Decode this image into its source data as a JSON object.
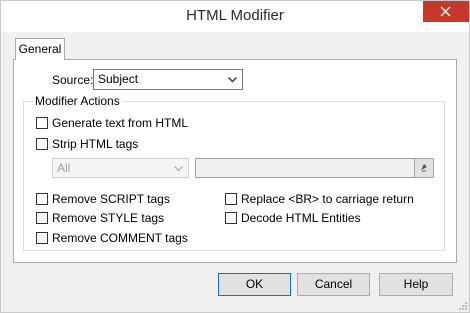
{
  "window": {
    "title": "HTML Modifier"
  },
  "tabs": [
    {
      "label": "General"
    }
  ],
  "source": {
    "label": "Source:",
    "value": "Subject"
  },
  "modifier_actions": {
    "group_label": "Modifier Actions",
    "generate_text": {
      "label": "Generate text from HTML",
      "checked": false
    },
    "strip_tags": {
      "label": "Strip HTML tags",
      "checked": false
    },
    "strip_mode": {
      "value": "All",
      "disabled": true
    },
    "remove_script": {
      "label": "Remove SCRIPT tags",
      "checked": false
    },
    "remove_style": {
      "label": "Remove STYLE tags",
      "checked": false
    },
    "remove_comment": {
      "label": "Remove COMMENT tags",
      "checked": false
    },
    "replace_br": {
      "label": "Replace <BR> to carriage return",
      "checked": false
    },
    "decode_entities": {
      "label": "Decode HTML Entities",
      "checked": false
    }
  },
  "buttons": {
    "ok": "OK",
    "cancel": "Cancel",
    "help": "Help"
  },
  "colors": {
    "close_button": "#c7372a",
    "default_button_border": "#0078d7"
  }
}
